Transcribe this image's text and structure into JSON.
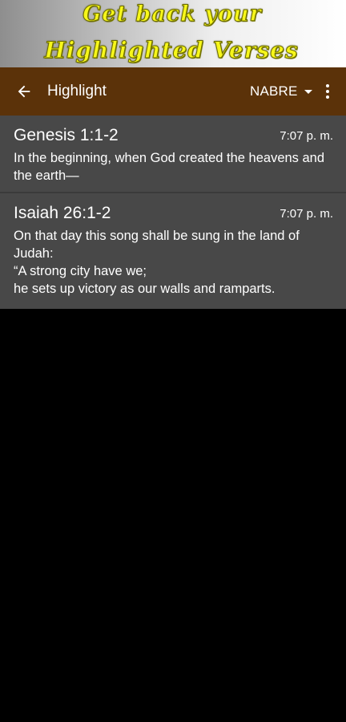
{
  "banner": {
    "line1": "Get back your",
    "line2": "Highlighted Verses",
    "text_color": "#f7f71a"
  },
  "appbar": {
    "title": "Highlight",
    "back_icon": "arrow-left-icon",
    "version": "NABRE",
    "version_dropdown_icon": "caret-down-icon",
    "more_icon": "more-vert-icon",
    "background": "#5b3209"
  },
  "highlights": [
    {
      "reference": "Genesis 1:1-2",
      "time": "7:07 p. m.",
      "text": "In the beginning, when God created the heavens and the earth—"
    },
    {
      "reference": "Isaiah 26:1-2",
      "time": "7:07 p. m.",
      "text": "On that day this song shall be sung in the land of Judah:\n“A strong city have we;\nhe sets up victory as our walls and ramparts."
    }
  ],
  "colors": {
    "list_item_bg": "#484848",
    "screen_bg": "#000000"
  }
}
